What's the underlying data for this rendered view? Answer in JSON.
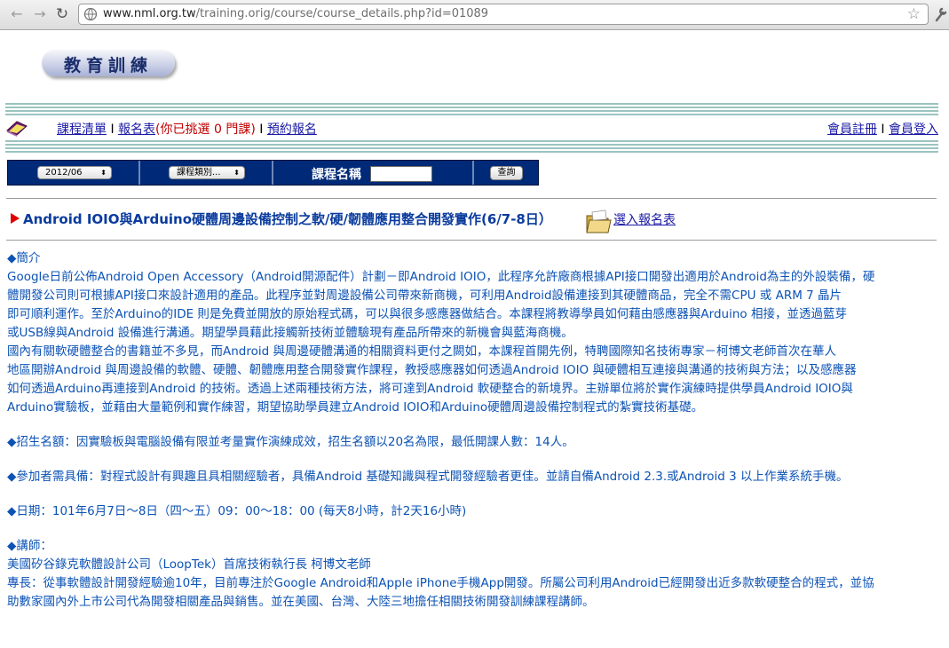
{
  "browser": {
    "url_host": "www.nml.org.tw",
    "url_path": "/training.orig/course/course_details.php?id=01089"
  },
  "logo": {
    "text": "教育訓練"
  },
  "nav": {
    "course_list": "課程清單",
    "sep1": " I ",
    "form": "報名表",
    "selected_prefix": "(你已挑選 ",
    "selected_count": "0",
    "selected_suffix": " 門課)",
    "sep2": " I ",
    "reserve": "預約報名",
    "register": "會員註冊",
    "sep3": " I ",
    "login": "會員登入"
  },
  "search": {
    "month": "2012/06",
    "category": "課程類別...",
    "name_label": "課程名稱",
    "button": "查詢"
  },
  "course": {
    "title": "Android IOIO與Arduino硬體周邊設備控制之軟/硬/韌體應用整合開發實作(6/7-8日）",
    "enroll_link": "選入報名表"
  },
  "sections": {
    "intro_heading": "◆簡介",
    "intro_lines": [
      "Google日前公佈Android Open Accessory（Android開源配件）計劃－即Android IOIO，此程序允許廠商根據API接口開發出適用於Android為主的外設裝備，硬",
      "體開發公司則可根據API接口來設計適用的產品。此程序並對周邊設備公司帶來新商機，可利用Android設備連接到其硬體商品，完全不需CPU 或 ARM 7 晶片",
      "即可順利運作。至於Arduino的IDE 則是免費並開放的原始程式碼，可以與很多感應器做結合。本課程將教導學員如何藉由感應器與Arduino 相接，並透過藍芽",
      "或USB線與Android 設備進行溝通。期望學員藉此接觸新技術並體驗現有產品所帶來的新機會與藍海商機。",
      "國內有關軟硬體整合的書籍並不多見，而Android 與周邊硬體溝通的相關資料更付之闕如，本課程首開先例，特聘國際知名技術專家－柯博文老師首次在華人",
      "地區開辦Android 與周邊設備的軟體、硬體、韌體應用整合開發實作課程，教授感應器如何透過Android IOIO 與硬體相互連接與溝通的技術與方法；以及感應器",
      "如何透過Arduino再連接到Android 的技術。透過上述兩種技術方法，將可達到Android 軟硬整合的新境界。主辦單位將於實作演練時提供學員Android IOIO與",
      "Arduino實驗板，並藉由大量範例和實作練習，期望協助學員建立Android IOIO和Arduino硬體周邊設備控制程式的紮實技術基礎。"
    ],
    "enroll": "◆招生名額：因實驗板與電腦設備有限並考量實作演練成效，招生名額以20名為限，最低開課人數：14人。",
    "prereq": "◆參加者需具備：對程式設計有興趣且具相關經驗者，具備Android 基礎知識與程式開發經驗者更佳。並請自備Android 2.3.或Android 3 以上作業系統手機。",
    "date": "◆日期：101年6月7日～8日（四～五）09：00～18：00 (每天8小時，計2天16小時)",
    "lecturer_heading": "◆講師：",
    "lecturer_lines": [
      "美國矽谷錄克軟體設計公司（LoopTek）首席技術執行長 柯博文老師",
      "專長：從事軟體設計開發經驗逾10年，目前專注於Google Android和Apple iPhone手機App開發。所屬公司利用Android已經開發出近多款軟硬整合的程式，並協",
      "助數家國內外上市公司代為開發相關產品與銷售。並在美國、台灣、大陸三地擔任相關技術開發訓練課程講師。"
    ]
  }
}
